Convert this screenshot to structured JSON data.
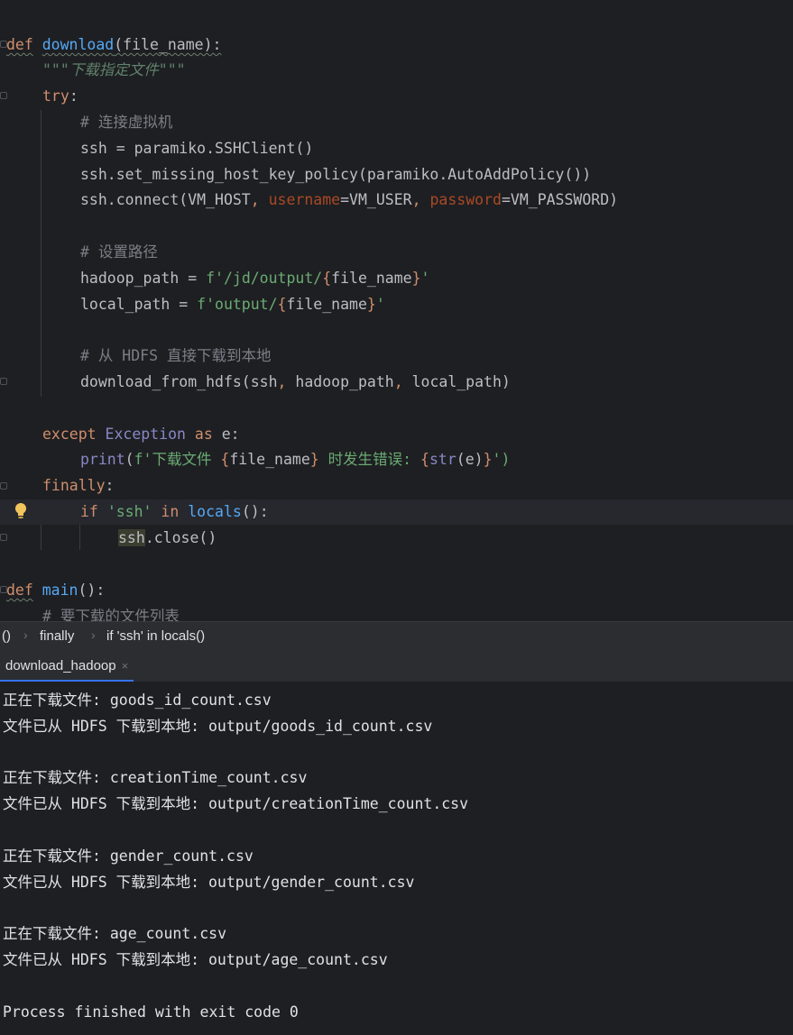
{
  "editor": {
    "def1_kw": "def",
    "def1_name": "download",
    "def1_params": "(file_name):",
    "docstring": "\"\"\"下载指定文件\"\"\"",
    "try_kw": "try",
    "colon": ":",
    "c1": "# 连接虚拟机",
    "l_ssh": "ssh = paramiko.SSHClient()",
    "l_policy": "ssh.set_missing_host_key_policy(paramiko.AutoAddPolicy())",
    "conn_a": "ssh.connect(VM_HOST",
    "comma": ", ",
    "conn_user_kw": "username",
    "conn_user_val": "=VM_USER",
    "conn_pw_kw": "password",
    "conn_pw_val": "=VM_PASSWORD)",
    "c2": "# 设置路径",
    "hp_a": "hadoop_path = ",
    "hp_s1": "f'/jd/output/",
    "lbrace": "{",
    "rbrace": "}",
    "var_file_name": "file_name",
    "quote": "'",
    "lp_a": "local_path = ",
    "lp_s1": "f'output/",
    "c3": "# 从 HDFS 直接下载到本地",
    "dl_a": "download_from_hdfs(ssh",
    "dl_b": "hadoop_path",
    "dl_c": "local_path)",
    "except_kw": "except",
    "exc_cls": "Exception",
    "as_kw": "as",
    "exc_var": "e:",
    "print_fn": "print",
    "lparen": "(",
    "pr_s1": "f'下载文件 ",
    "pr_s2": " 时发生错误: ",
    "str_fn": "str",
    "pr_e": "(e)",
    "pr_end": "')",
    "finally_kw": "finally",
    "if_kw": "if",
    "ssh_str": "'ssh'",
    "in_kw": "in",
    "locals_fn": "locals",
    "if_end": "():",
    "close_var": "ssh",
    "close_rest": ".close()",
    "def2_kw": "def",
    "def2_name": "main",
    "def2_params": "():",
    "c4": "# 要下载的文件列表"
  },
  "breadcrumb": {
    "items": [
      "()",
      "finally",
      "if 'ssh' in locals()"
    ],
    "sep": "›"
  },
  "run_tab": {
    "label": "download_hadoop",
    "close": "×"
  },
  "console": {
    "lines": [
      "正在下载文件: goods_id_count.csv",
      "文件已从 HDFS 下载到本地: output/goods_id_count.csv",
      "",
      "正在下载文件: creationTime_count.csv",
      "文件已从 HDFS 下载到本地: output/creationTime_count.csv",
      "",
      "正在下载文件: gender_count.csv",
      "文件已从 HDFS 下载到本地: output/gender_count.csv",
      "",
      "正在下载文件: age_count.csv",
      "文件已从 HDFS 下载到本地: output/age_count.csv",
      "",
      "Process finished with exit code 0"
    ]
  },
  "colors": {
    "background": "#1e1f22",
    "keyword": "#cf8e6d",
    "function": "#56a8f5",
    "string": "#6aab73",
    "comment": "#7a7e85",
    "param_name": "#aa4926",
    "builtin": "#8888c6"
  },
  "icons": [
    "intention-bulb-icon",
    "close-icon",
    "chevron-right-icon"
  ]
}
